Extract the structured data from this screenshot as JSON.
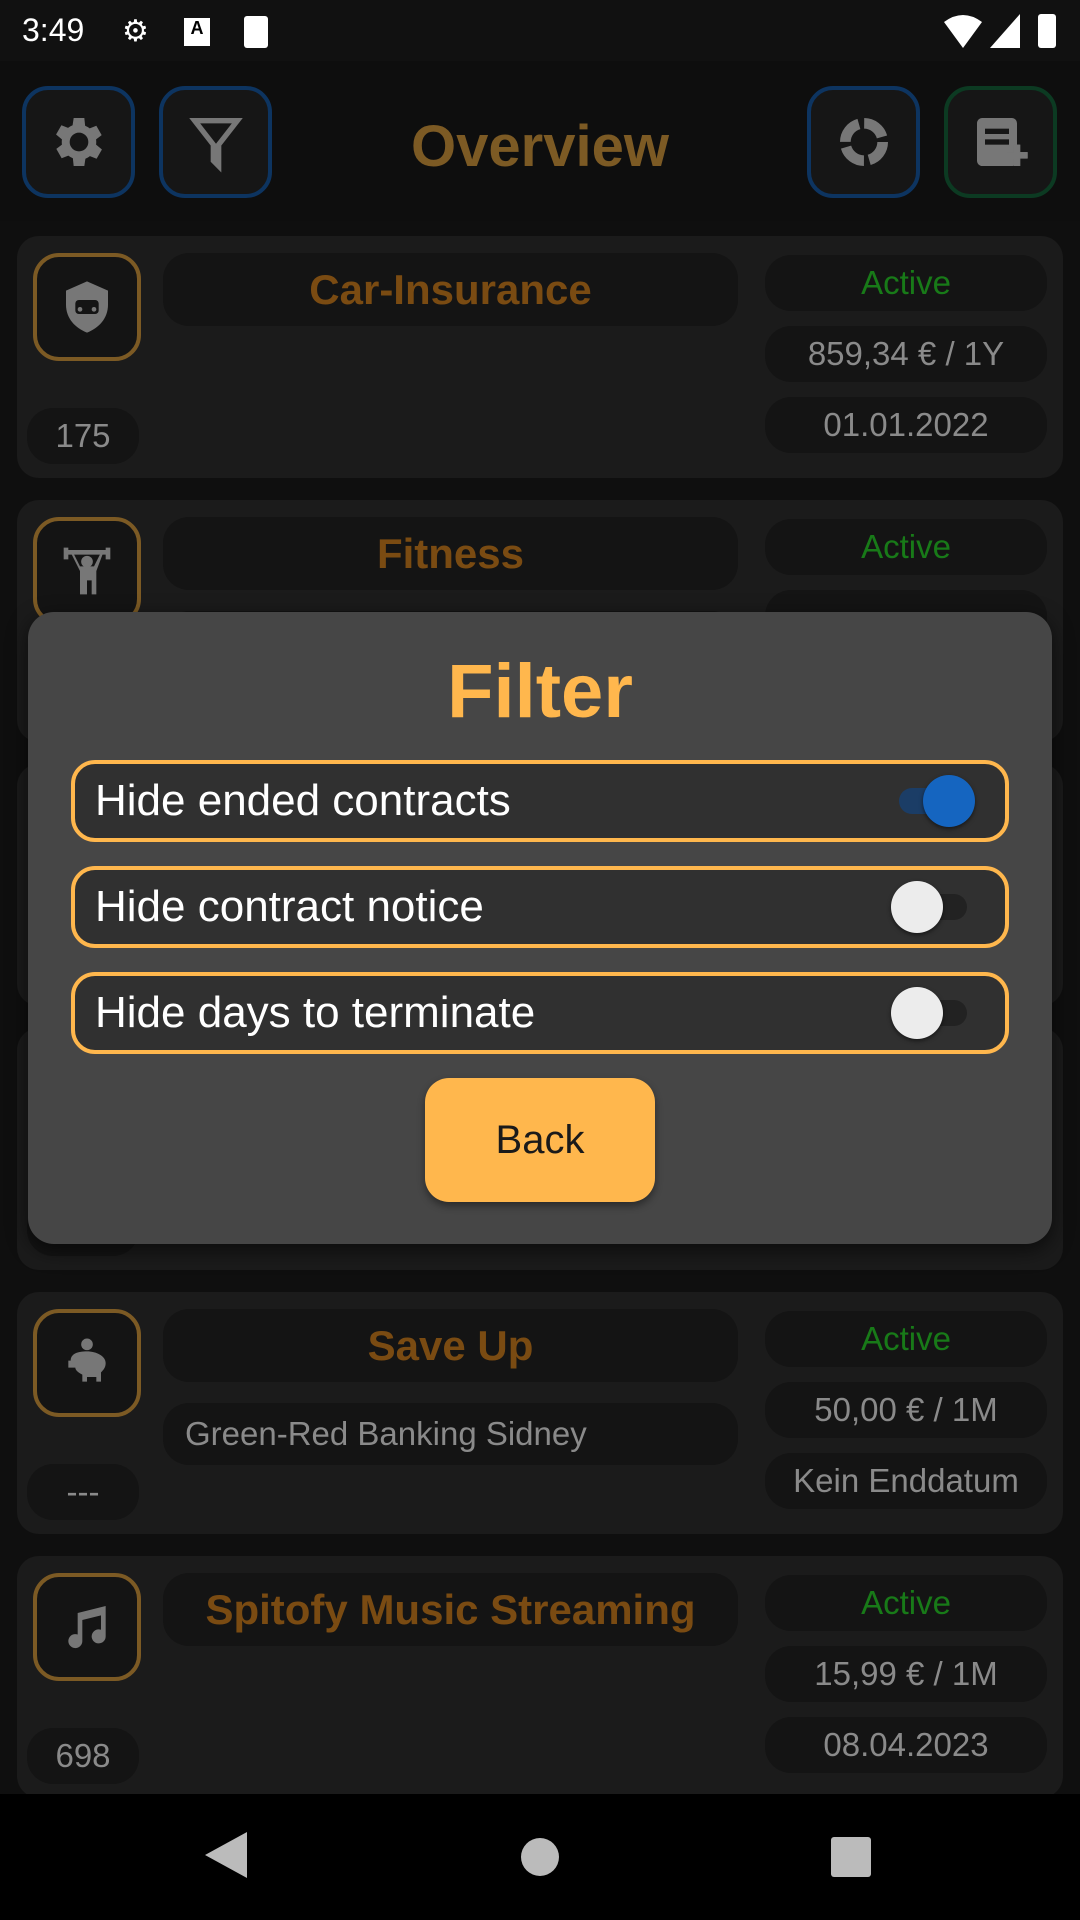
{
  "status_bar": {
    "time": "3:49",
    "icons": [
      "settings-icon",
      "keyboard-a-icon",
      "sd-card-icon",
      "wifi-icon",
      "signal-icon",
      "battery-icon"
    ]
  },
  "toolbar": {
    "title": "Overview",
    "buttons": [
      "settings-icon",
      "filter-icon",
      "statistics-donut-icon",
      "add-contract-icon"
    ]
  },
  "contracts": [
    {
      "name": "Car-Insurance",
      "icon": "car-shield-icon",
      "status": "Active",
      "price": "859,34 € / 1Y",
      "date": "01.01.2022",
      "days": "175",
      "subtitle": ""
    },
    {
      "name": "Fitness",
      "icon": "weightlifting-icon",
      "status": "Active"
    },
    {},
    {},
    {
      "name": "Save Up",
      "icon": "piggy-bank-icon",
      "status": "Active",
      "price": "50,00 € / 1M",
      "date": "Kein Enddatum",
      "days": "---",
      "subtitle": "Green-Red Banking Sidney"
    },
    {
      "name": "Spitofy Music Streaming",
      "icon": "music-note-icon",
      "status": "Active",
      "price": "15,99 € / 1M",
      "date": "08.04.2023",
      "days": "698",
      "subtitle": ""
    }
  ],
  "dialog": {
    "title": "Filter",
    "options": [
      {
        "label": "Hide ended contracts",
        "checked": true
      },
      {
        "label": "Hide contract notice",
        "checked": false
      },
      {
        "label": "Hide days to terminate",
        "checked": false
      }
    ],
    "back_label": "Back"
  },
  "colors": {
    "accent": "#ffb74d",
    "toggle_on": "#1565c0",
    "active_status": "#187a18"
  },
  "nav": [
    "back-icon",
    "home-icon",
    "recents-icon"
  ]
}
